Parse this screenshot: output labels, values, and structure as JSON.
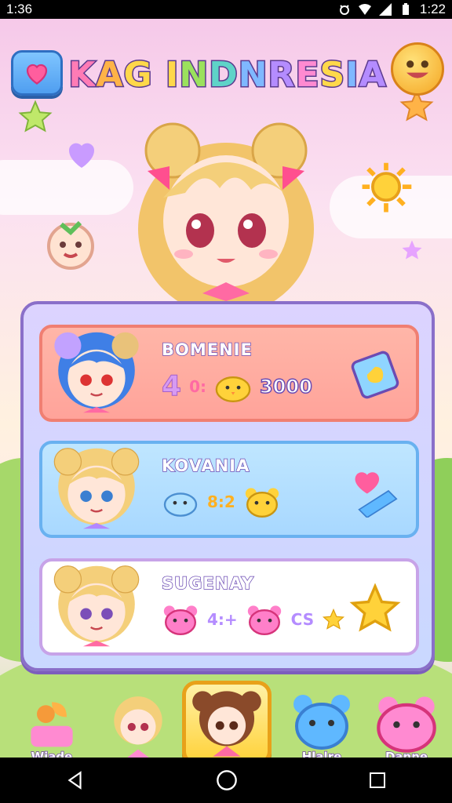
{
  "status_bar": {
    "time_left": "1:36",
    "time_right": "1:22"
  },
  "header": {
    "title_letters": [
      "K",
      "A",
      "G",
      " ",
      "I",
      "N",
      "D",
      "N",
      "R",
      "E",
      "S",
      "I",
      "A"
    ],
    "title_colors": [
      "#ff7bb5",
      "#ffb347",
      "#ffd84a",
      "",
      "#ffd84a",
      "#9be15d",
      "#5fd3c8",
      "#7fb8ff",
      "#b48cff",
      "#ff8ad1",
      "#ffd84a",
      "#7fb8ff",
      "#b48cff"
    ]
  },
  "roster": [
    {
      "name": "BOMENIE",
      "stat_a": "4",
      "stat_b": "0:",
      "stat_value": "3000",
      "pet_color": "#ffd23a",
      "card_theme": "pink"
    },
    {
      "name": "KOVANIA",
      "stat_b": "8:2",
      "pet_color": "#ffd23a",
      "card_theme": "blue"
    },
    {
      "name": "SUGENAY",
      "stat_b": "4:+",
      "stat_c": "CS",
      "pet_color": "#ff7fc9",
      "card_theme": "white"
    }
  ],
  "nav": {
    "items": [
      {
        "label": "Wiade"
      },
      {
        "label": ""
      },
      {
        "label": ""
      },
      {
        "label": "Hlalre"
      },
      {
        "label": "Danne"
      }
    ]
  },
  "colors": {
    "accent_purple": "#6b4bb3",
    "gold": "#ffd23a",
    "pink": "#ff7bb5"
  },
  "icons": [
    "heart-icon",
    "smiley-icon",
    "star-icon",
    "sun-icon",
    "heart-arrow-icon",
    "back-icon",
    "home-icon",
    "recents-icon"
  ]
}
